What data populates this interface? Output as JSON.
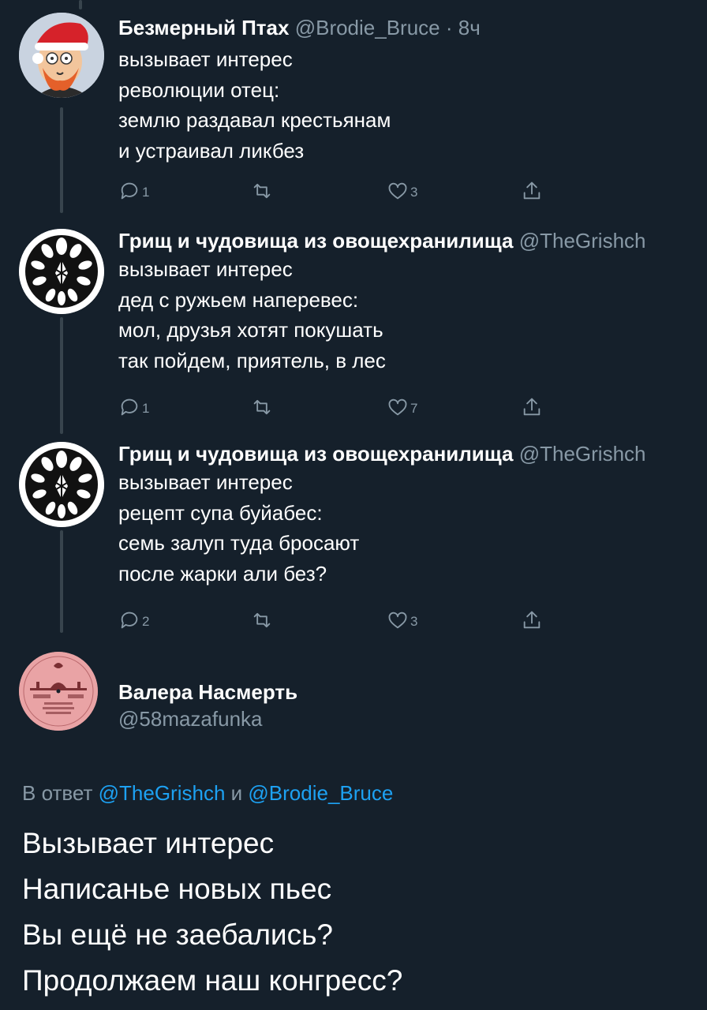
{
  "colors": {
    "background": "#15202b",
    "secondary_text": "#8899a6",
    "link": "#1da1f2",
    "thread_line": "#38444d"
  },
  "tweets": [
    {
      "name": "Безмерный Птах",
      "handle": "@Brodie_Bruce",
      "dot": "·",
      "time": "8ч",
      "lines": [
        "вызывает интерес",
        "революции отец:",
        "землю раздавал крестьянам",
        "и устраивал ликбез"
      ],
      "reply_count": "1",
      "retweet_count": "",
      "like_count": "3",
      "avatar": "cartoon-santa-avatar"
    },
    {
      "name": "Грищ и чудовища из овощехранилища",
      "handle": "@TheGrishch",
      "lines": [
        "вызывает интерес",
        "дед с ружьем наперевес:",
        "мол, друзья хотят покушать",
        "так пойдем, приятель, в лес"
      ],
      "reply_count": "1",
      "retweet_count": "",
      "like_count": "7",
      "avatar": "ornament-avatar"
    },
    {
      "name": "Грищ и чудовища из овощехранилища",
      "handle": "@TheGrishch",
      "lines": [
        "вызывает интерес",
        "рецепт супа буйабес:",
        "семь залуп туда бросают",
        "после жарки али без?"
      ],
      "reply_count": "2",
      "retweet_count": "",
      "like_count": "3",
      "avatar": "ornament-avatar"
    }
  ],
  "focus": {
    "name": "Валера Насмерть",
    "handle": "@58mazafunka",
    "avatar": "vinyl-record-label-avatar",
    "reply_prefix": "В ответ",
    "reply_user_1": "@TheGrishch",
    "reply_and": "и",
    "reply_user_2": "@Brodie_Bruce",
    "lines": [
      "Вызывает интерес",
      "Написанье новых пьес",
      "Вы ещё не заебались?",
      "Продолжаем наш конгресс?"
    ]
  }
}
